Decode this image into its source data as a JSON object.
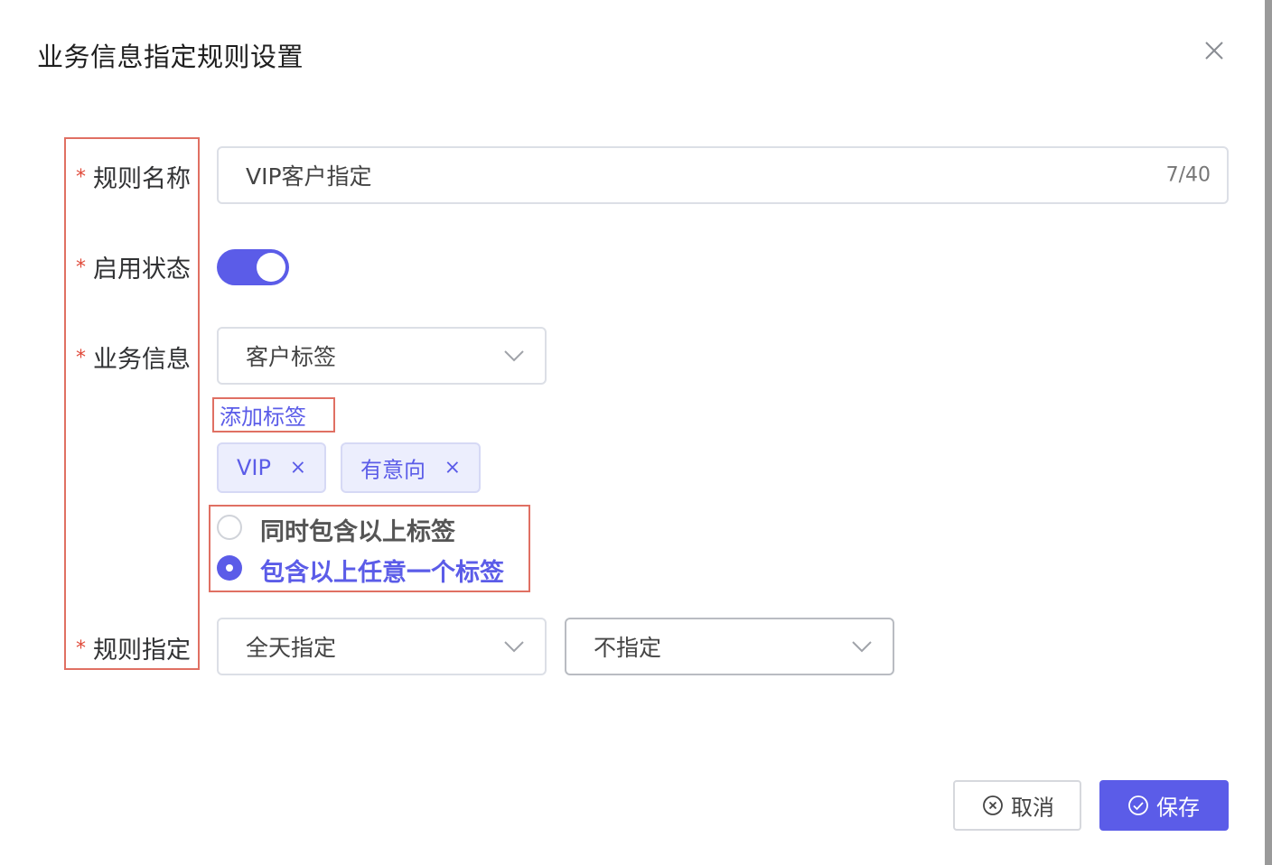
{
  "dialog": {
    "title": "业务信息指定规则设置",
    "close_icon": "close-icon"
  },
  "form": {
    "required_mark": "*",
    "rule_name": {
      "label": "规则名称",
      "value": "VIP客户指定",
      "counter": "7/40"
    },
    "status": {
      "label": "启用状态",
      "enabled": true
    },
    "business_info": {
      "label": "业务信息",
      "select_value": "客户标签",
      "add_tag_link": "添加标签",
      "tags": [
        {
          "text": "VIP",
          "remove": "×"
        },
        {
          "text": "有意向",
          "remove": "×"
        }
      ],
      "match_options": [
        {
          "label": "同时包含以上标签",
          "selected": false
        },
        {
          "label": "包含以上任意一个标签",
          "selected": true
        }
      ]
    },
    "rule_assign": {
      "label": "规则指定",
      "select_time": "全天指定",
      "select_target": "不指定"
    }
  },
  "footer": {
    "cancel_label": "取消",
    "save_label": "保存"
  },
  "colors": {
    "accent": "#5b5ce8",
    "annotation": "#e07063",
    "required": "#e04a3a"
  }
}
